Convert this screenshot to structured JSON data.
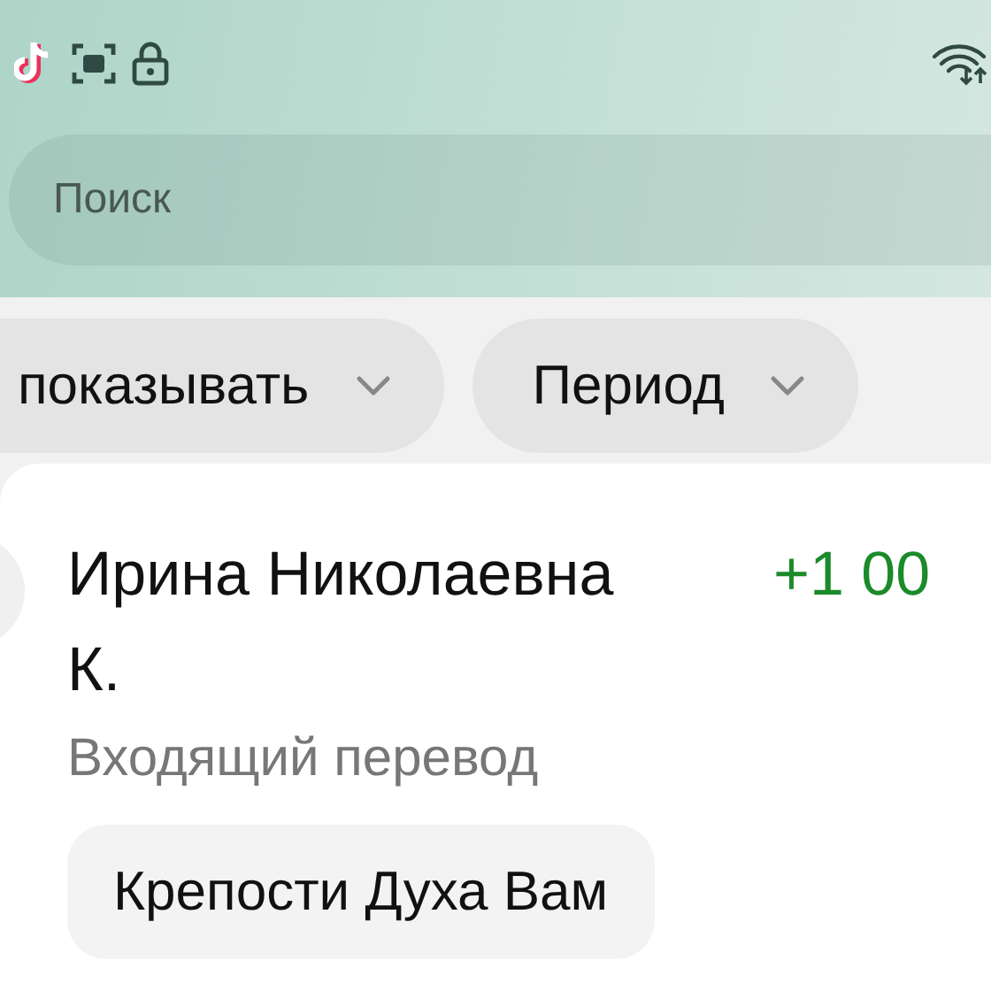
{
  "search": {
    "placeholder": "Поиск"
  },
  "filters": [
    {
      "label": "показывать"
    },
    {
      "label": "Период"
    }
  ],
  "transaction": {
    "name": "Ирина Николаевна К.",
    "type": "Входящий перевод",
    "amount": "+1 00",
    "message": "Крепости Духа Вам"
  }
}
